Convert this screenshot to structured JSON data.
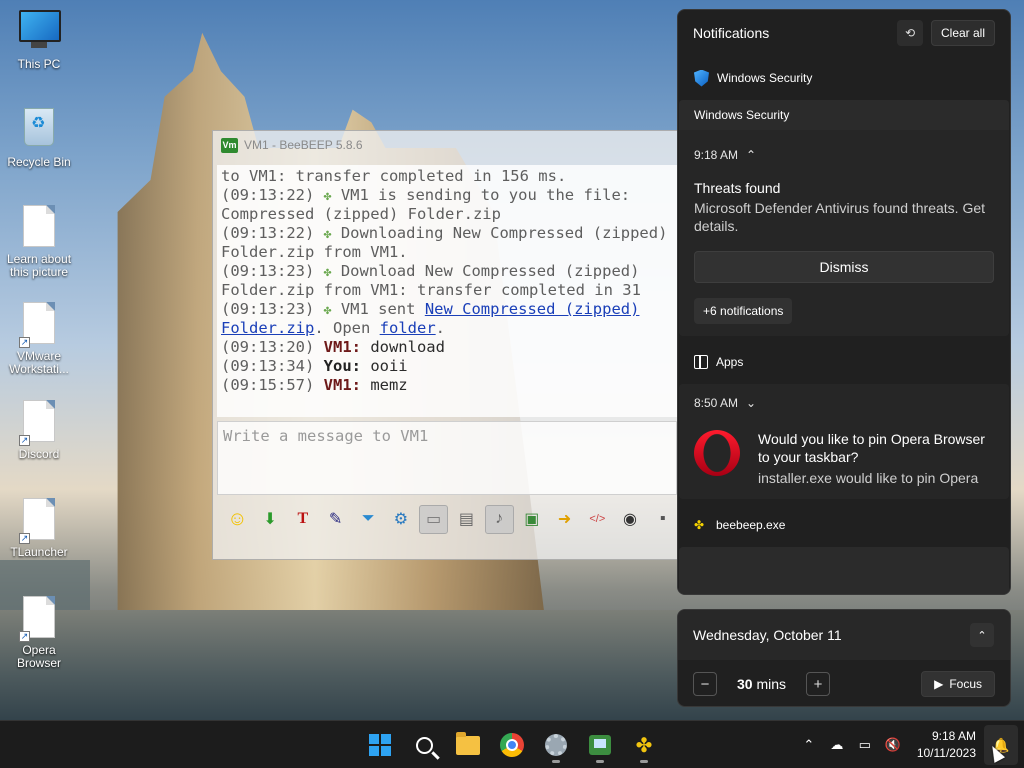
{
  "desktop": {
    "icons": [
      {
        "label": "This PC"
      },
      {
        "label": "Recycle Bin"
      },
      {
        "label": "Learn about this picture"
      },
      {
        "label": "VMware Workstati..."
      },
      {
        "label": "Discord"
      },
      {
        "label": "TLauncher"
      },
      {
        "label": "Opera Browser"
      }
    ]
  },
  "beebeep": {
    "title": "VM1 - BeeBEEP 5.8.6",
    "logo_text": "Vm",
    "chat_lines": [
      "to VM1: transfer completed in 156 ms.",
      "(09:13:22) ",
      " VM1 is sending to you the file:",
      "Compressed (zipped) Folder.zip",
      "(09:13:22) ",
      " Downloading New Compressed (zipped)",
      "Folder.zip from VM1.",
      "(09:13:23) ",
      " Download New Compressed (zipped)",
      "Folder.zip from VM1: transfer completed in 31",
      "(09:13:23) ",
      " VM1 sent ",
      "New Compressed (zipped)",
      "Folder.zip",
      ". Open ",
      "folder",
      ".",
      "(09:13:20) ",
      "VM1:",
      " download",
      "(09:13:34) ",
      "You:",
      " ooii",
      "(09:15:57) ",
      "VM1:",
      " memz"
    ],
    "input_placeholder": "Write a message to VM1",
    "toolbar_icons": [
      "smiley-icon",
      "download-icon",
      "text-format-icon",
      "color-wand-icon",
      "filter-icon",
      "settings-icon",
      "screenshot-icon",
      "theme-icon",
      "music-icon",
      "save-chat-icon",
      "send-file-icon",
      "html-icon",
      "webcam-icon",
      "more-icon"
    ]
  },
  "notifications": {
    "title": "Notifications",
    "clear_all": "Clear all",
    "groups": [
      {
        "app": "Windows Security",
        "subheader": "Windows Security",
        "time": "9:18 AM",
        "heading": "Threats found",
        "body": "Microsoft Defender Antivirus found threats. Get details.",
        "dismiss": "Dismiss",
        "more": "+6 notifications"
      },
      {
        "app": "Apps",
        "time": "8:50 AM",
        "heading": "Would you like to pin Opera Browser to your taskbar?",
        "body": "installer.exe would like to pin Opera"
      },
      {
        "app": "beebeep.exe"
      }
    ]
  },
  "calendar": {
    "date": "Wednesday, October 11",
    "focus_minutes": "30",
    "minutes_unit": "mins",
    "focus_label": "Focus"
  },
  "taskbar": {
    "time": "9:18 AM",
    "date": "10/11/2023"
  },
  "colors": {
    "accent": "#2ea3f2",
    "opera_red": "#ff1b2d",
    "panel_bg": "#202020"
  }
}
